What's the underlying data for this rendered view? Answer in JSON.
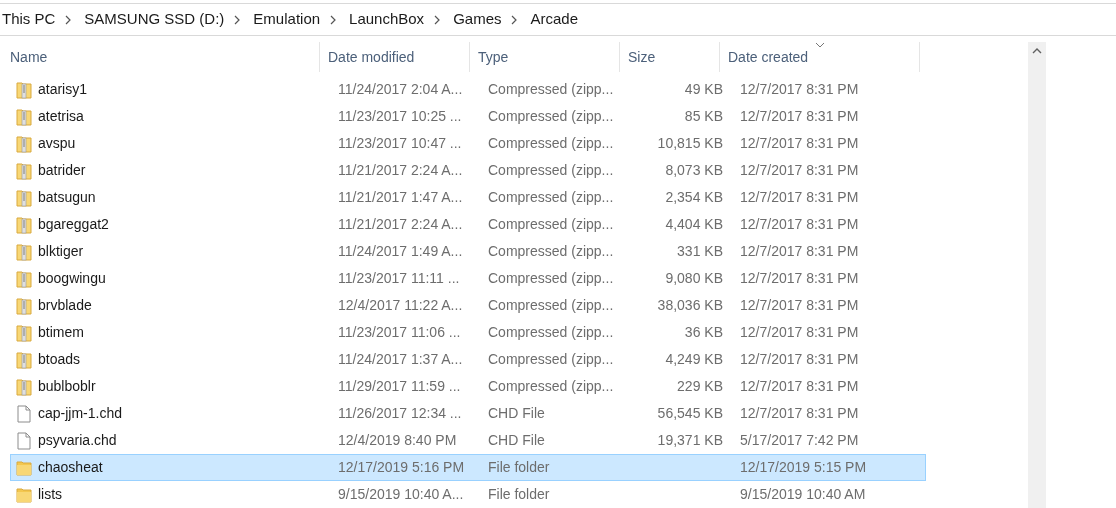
{
  "breadcrumb": [
    "This PC",
    "SAMSUNG SSD (D:)",
    "Emulation",
    "LaunchBox",
    "Games",
    "Arcade"
  ],
  "columns": [
    {
      "label": "Name",
      "sorted": false
    },
    {
      "label": "Date modified",
      "sorted": false
    },
    {
      "label": "Type",
      "sorted": false
    },
    {
      "label": "Size",
      "sorted": false
    },
    {
      "label": "Date created",
      "sorted": true
    }
  ],
  "rows": [
    {
      "kind": "zip",
      "name": "atarisy1",
      "modified": "11/24/2017 2:04 A...",
      "type": "Compressed (zipp...",
      "size": "49 KB",
      "created": "12/7/2017 8:31 PM",
      "selected": false
    },
    {
      "kind": "zip",
      "name": "atetrisa",
      "modified": "11/23/2017 10:25 ...",
      "type": "Compressed (zipp...",
      "size": "85 KB",
      "created": "12/7/2017 8:31 PM",
      "selected": false
    },
    {
      "kind": "zip",
      "name": "avspu",
      "modified": "11/23/2017 10:47 ...",
      "type": "Compressed (zipp...",
      "size": "10,815 KB",
      "created": "12/7/2017 8:31 PM",
      "selected": false
    },
    {
      "kind": "zip",
      "name": "batrider",
      "modified": "11/21/2017 2:24 A...",
      "type": "Compressed (zipp...",
      "size": "8,073 KB",
      "created": "12/7/2017 8:31 PM",
      "selected": false
    },
    {
      "kind": "zip",
      "name": "batsugun",
      "modified": "11/21/2017 1:47 A...",
      "type": "Compressed (zipp...",
      "size": "2,354 KB",
      "created": "12/7/2017 8:31 PM",
      "selected": false
    },
    {
      "kind": "zip",
      "name": "bgareggat2",
      "modified": "11/21/2017 2:24 A...",
      "type": "Compressed (zipp...",
      "size": "4,404 KB",
      "created": "12/7/2017 8:31 PM",
      "selected": false
    },
    {
      "kind": "zip",
      "name": "blktiger",
      "modified": "11/24/2017 1:49 A...",
      "type": "Compressed (zipp...",
      "size": "331 KB",
      "created": "12/7/2017 8:31 PM",
      "selected": false
    },
    {
      "kind": "zip",
      "name": "boogwingu",
      "modified": "11/23/2017 11:11 ...",
      "type": "Compressed (zipp...",
      "size": "9,080 KB",
      "created": "12/7/2017 8:31 PM",
      "selected": false
    },
    {
      "kind": "zip",
      "name": "brvblade",
      "modified": "12/4/2017 11:22 A...",
      "type": "Compressed (zipp...",
      "size": "38,036 KB",
      "created": "12/7/2017 8:31 PM",
      "selected": false
    },
    {
      "kind": "zip",
      "name": "btimem",
      "modified": "11/23/2017 11:06 ...",
      "type": "Compressed (zipp...",
      "size": "36 KB",
      "created": "12/7/2017 8:31 PM",
      "selected": false
    },
    {
      "kind": "zip",
      "name": "btoads",
      "modified": "11/24/2017 1:37 A...",
      "type": "Compressed (zipp...",
      "size": "4,249 KB",
      "created": "12/7/2017 8:31 PM",
      "selected": false
    },
    {
      "kind": "zip",
      "name": "bublboblr",
      "modified": "11/29/2017 11:59 ...",
      "type": "Compressed (zipp...",
      "size": "229 KB",
      "created": "12/7/2017 8:31 PM",
      "selected": false
    },
    {
      "kind": "file",
      "name": "cap-jjm-1.chd",
      "modified": "11/26/2017 12:34 ...",
      "type": "CHD File",
      "size": "56,545 KB",
      "created": "12/7/2017 8:31 PM",
      "selected": false
    },
    {
      "kind": "file",
      "name": "psyvaria.chd",
      "modified": "12/4/2019 8:40 PM",
      "type": "CHD File",
      "size": "19,371 KB",
      "created": "5/17/2017 7:42 PM",
      "selected": false
    },
    {
      "kind": "folder",
      "name": "chaosheat",
      "modified": "12/17/2019 5:16 PM",
      "type": "File folder",
      "created": "12/17/2019 5:15 PM",
      "selected": true
    },
    {
      "kind": "folder",
      "name": "lists",
      "modified": "9/15/2019 10:40 A...",
      "type": "File folder",
      "created": "9/15/2019 10:40 AM",
      "selected": false
    }
  ]
}
